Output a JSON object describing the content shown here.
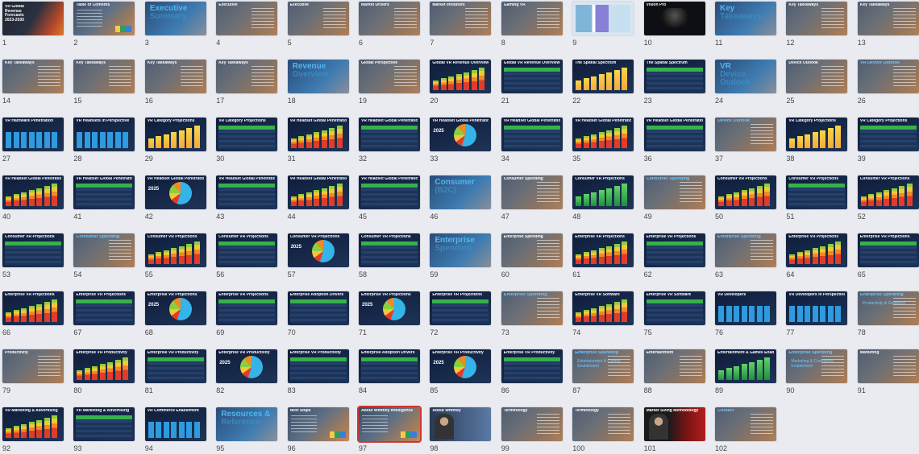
{
  "colors": {
    "selected_outline": "#d0342c",
    "table_header": "#36b24a",
    "accent_blue": "#4fb6f2"
  },
  "slides": [
    {
      "n": "1",
      "kind": "cover",
      "title": "VR Global Revenue Forecasts 2023-2030"
    },
    {
      "n": "2",
      "kind": "toc",
      "title": "Table of Contents"
    },
    {
      "n": "3",
      "kind": "section",
      "title": "Executive",
      "title2": "Summary"
    },
    {
      "n": "4",
      "kind": "text",
      "title": "Executive"
    },
    {
      "n": "5",
      "kind": "text",
      "title": "Executive"
    },
    {
      "n": "6",
      "kind": "text",
      "title": "Market Drivers"
    },
    {
      "n": "7",
      "kind": "text",
      "title": "Market Inhibitors"
    },
    {
      "n": "8",
      "kind": "text",
      "title": "Gaming VR"
    },
    {
      "n": "9",
      "kind": "screenshot",
      "title": ""
    },
    {
      "n": "10",
      "kind": "headset",
      "title": "Vision Pro"
    },
    {
      "n": "11",
      "kind": "section",
      "title": "Key",
      "title2": "Takeaways"
    },
    {
      "n": "12",
      "kind": "text",
      "title": "Key Takeaways"
    },
    {
      "n": "13",
      "kind": "text",
      "title": "Key Takeaways"
    },
    {
      "n": "14",
      "kind": "text",
      "title": "Key Takeaways"
    },
    {
      "n": "15",
      "kind": "text",
      "title": "Key Takeaways"
    },
    {
      "n": "16",
      "kind": "text",
      "title": "Key Takeaways"
    },
    {
      "n": "17",
      "kind": "text",
      "title": "Key Takeaways"
    },
    {
      "n": "18",
      "kind": "section",
      "title": "Revenue",
      "title2": "Overview"
    },
    {
      "n": "19",
      "kind": "text",
      "title": "Global Perspective"
    },
    {
      "n": "20",
      "kind": "stacked",
      "title": "Global VR Revenue Overview"
    },
    {
      "n": "21",
      "kind": "table",
      "title": "Global VR Revenue Overview"
    },
    {
      "n": "22",
      "kind": "yellowbars",
      "title": "The Spatial Spectrum"
    },
    {
      "n": "23",
      "kind": "table",
      "title": "The Spatial Spectrum"
    },
    {
      "n": "24",
      "kind": "section",
      "title": "VR",
      "title2": "Device Outlook"
    },
    {
      "n": "25",
      "kind": "text",
      "title": "Device Outlook"
    },
    {
      "n": "26",
      "kind": "section-small",
      "title": "VR Device Outlook"
    },
    {
      "n": "27",
      "kind": "bluebars",
      "title": "VR Hardware Penetration"
    },
    {
      "n": "28",
      "kind": "bluebars",
      "title": "VR Headsets in Perspective"
    },
    {
      "n": "29",
      "kind": "yellowbars",
      "title": "VR Category Projections"
    },
    {
      "n": "30",
      "kind": "table",
      "title": "VR Category Projections"
    },
    {
      "n": "31",
      "kind": "stacked",
      "title": "VR Headset Global Penetration"
    },
    {
      "n": "32",
      "kind": "table",
      "title": "VR Headset Global Penetration"
    },
    {
      "n": "33",
      "kind": "pie",
      "title": "VR Headset Global Penetration",
      "year": "2025"
    },
    {
      "n": "34",
      "kind": "table",
      "title": "VR Headset Global Penetration"
    },
    {
      "n": "35",
      "kind": "stacked",
      "title": "VR Headset Global Penetration"
    },
    {
      "n": "36",
      "kind": "table",
      "title": "VR Headset Global Penetration"
    },
    {
      "n": "37",
      "kind": "section-small",
      "title": "Device Outlook"
    },
    {
      "n": "38",
      "kind": "yellowbars",
      "title": "VR Category Projections"
    },
    {
      "n": "39",
      "kind": "table",
      "title": "VR Category Projections"
    },
    {
      "n": "40",
      "kind": "stacked",
      "title": "VR Headset Global Penetration"
    },
    {
      "n": "41",
      "kind": "table",
      "title": "VR Headset Global Penetration"
    },
    {
      "n": "42",
      "kind": "pie",
      "title": "VR Headset Global Penetration",
      "year": "2025"
    },
    {
      "n": "43",
      "kind": "table",
      "title": "VR Headset Global Penetration"
    },
    {
      "n": "44",
      "kind": "stacked",
      "title": "VR Headset Global Penetration"
    },
    {
      "n": "45",
      "kind": "table",
      "title": "VR Headset Global Penetration"
    },
    {
      "n": "46",
      "kind": "section",
      "title": "Consumer",
      "title2": "(B2C)"
    },
    {
      "n": "47",
      "kind": "text",
      "title": "Consumer Spending"
    },
    {
      "n": "48",
      "kind": "greenbars",
      "title": "Consumer VR Projections"
    },
    {
      "n": "49",
      "kind": "section-small",
      "title": "Consumer Spending"
    },
    {
      "n": "50",
      "kind": "stacked",
      "title": "Consumer VR Projections"
    },
    {
      "n": "51",
      "kind": "table",
      "title": "Consumer VR Projections"
    },
    {
      "n": "52",
      "kind": "stacked",
      "title": "Consumer VR Projections"
    },
    {
      "n": "53",
      "kind": "table",
      "title": "Consumer VR Projections"
    },
    {
      "n": "54",
      "kind": "section-small",
      "title": "Consumer Spending"
    },
    {
      "n": "55",
      "kind": "stacked",
      "title": "Consumer VR Projections"
    },
    {
      "n": "56",
      "kind": "table",
      "title": "Consumer VR Projections"
    },
    {
      "n": "57",
      "kind": "pie",
      "title": "Consumer VR Projections",
      "year": "2025"
    },
    {
      "n": "58",
      "kind": "table",
      "title": "Consumer VR Projections"
    },
    {
      "n": "59",
      "kind": "section",
      "title": "Enterprise",
      "title2": "Spending"
    },
    {
      "n": "60",
      "kind": "text",
      "title": "Enterprise Spending"
    },
    {
      "n": "61",
      "kind": "stacked",
      "title": "Enterprise VR Projections"
    },
    {
      "n": "62",
      "kind": "table",
      "title": "Enterprise VR Projections"
    },
    {
      "n": "63",
      "kind": "section-small",
      "title": "Enterprise Spending"
    },
    {
      "n": "64",
      "kind": "stacked",
      "title": "Enterprise VR Projections"
    },
    {
      "n": "65",
      "kind": "table",
      "title": "Enterprise VR Projections"
    },
    {
      "n": "66",
      "kind": "stacked",
      "title": "Enterprise VR Projections"
    },
    {
      "n": "67",
      "kind": "table",
      "title": "Enterprise VR Projections"
    },
    {
      "n": "68",
      "kind": "pie",
      "title": "Enterprise VR Projections",
      "year": "2025"
    },
    {
      "n": "69",
      "kind": "table",
      "title": "Enterprise VR Projections"
    },
    {
      "n": "70",
      "kind": "table",
      "title": "Enterprise Adoption Drivers"
    },
    {
      "n": "71",
      "kind": "pie",
      "title": "Enterprise VR Projections",
      "year": "2025"
    },
    {
      "n": "72",
      "kind": "table",
      "title": "Enterprise VR Projections"
    },
    {
      "n": "73",
      "kind": "section-small",
      "title": "Enterprise Spending"
    },
    {
      "n": "74",
      "kind": "stacked",
      "title": "Enterprise VR Software"
    },
    {
      "n": "75",
      "kind": "table",
      "title": "Enterprise VR Software"
    },
    {
      "n": "76",
      "kind": "bluebars",
      "title": "VR Developers"
    },
    {
      "n": "77",
      "kind": "bluebars",
      "title": "VR Developers in Perspective"
    },
    {
      "n": "78",
      "kind": "section-small",
      "title": "Enterprise Spending",
      "sub": "Productivity & Guidance"
    },
    {
      "n": "79",
      "kind": "text",
      "title": "Productivity"
    },
    {
      "n": "80",
      "kind": "stacked",
      "title": "Enterprise VR Productivity"
    },
    {
      "n": "81",
      "kind": "table",
      "title": "Enterprise VR Productivity"
    },
    {
      "n": "82",
      "kind": "pie",
      "title": "Enterprise VR Productivity",
      "year": "2025"
    },
    {
      "n": "83",
      "kind": "table",
      "title": "Enterprise VR Productivity"
    },
    {
      "n": "84",
      "kind": "table",
      "title": "Enterprise Adoption Drivers"
    },
    {
      "n": "85",
      "kind": "pie",
      "title": "Enterprise VR Productivity",
      "year": "2025"
    },
    {
      "n": "86",
      "kind": "table",
      "title": "Enterprise VR Productivity"
    },
    {
      "n": "87",
      "kind": "section-small",
      "title": "Enterprise Spending",
      "sub": "Entertainment & Games Enablement"
    },
    {
      "n": "88",
      "kind": "text",
      "title": "Entertainment"
    },
    {
      "n": "89",
      "kind": "greenbars",
      "title": "Entertainment & Games Enablement"
    },
    {
      "n": "90",
      "kind": "section-small",
      "title": "Enterprise Spending",
      "sub": "Marketing & Commerce Enablement"
    },
    {
      "n": "91",
      "kind": "text",
      "title": "Marketing"
    },
    {
      "n": "92",
      "kind": "stacked",
      "title": "VR Marketing & Advertising"
    },
    {
      "n": "93",
      "kind": "table",
      "title": "VR Marketing & Advertising"
    },
    {
      "n": "94",
      "kind": "bluebars",
      "title": "VR Commerce Enablement"
    },
    {
      "n": "95",
      "kind": "section",
      "title": "Resources &",
      "title2": "Reference"
    },
    {
      "n": "96",
      "kind": "textlogo",
      "title": "Next Steps"
    },
    {
      "n": "97",
      "kind": "textlogo",
      "title": "About Whitney Intelligence",
      "selected": true
    },
    {
      "n": "98",
      "kind": "people",
      "title": "About Whitney"
    },
    {
      "n": "99",
      "kind": "text",
      "title": "Terminology"
    },
    {
      "n": "100",
      "kind": "text",
      "title": "Terminology"
    },
    {
      "n": "101",
      "kind": "video",
      "title": "Market Sizing Methodology"
    },
    {
      "n": "102",
      "kind": "contact",
      "title": "Contact"
    }
  ]
}
